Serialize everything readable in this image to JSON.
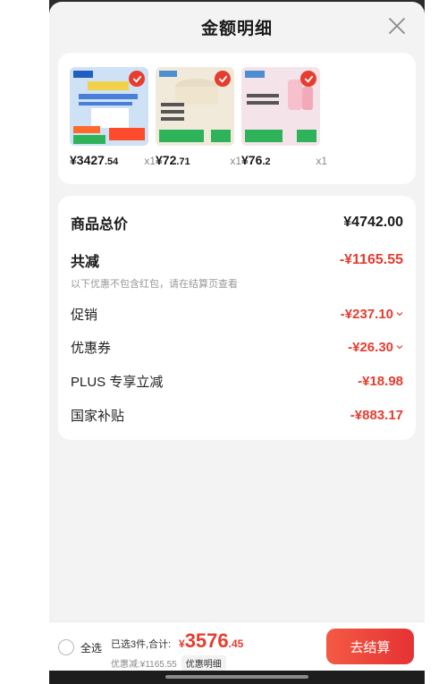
{
  "sheet": {
    "title": "金额明细"
  },
  "products": [
    {
      "price_int": "¥3427",
      "price_dec": ".54",
      "qty": "x1",
      "thumb_color": "#dbe9f7"
    },
    {
      "price_int": "¥72",
      "price_dec": ".71",
      "qty": "x1",
      "thumb_color": "#f4efe3"
    },
    {
      "price_int": "¥76",
      "price_dec": ".2",
      "qty": "x1",
      "thumb_color": "#f7e9ee"
    }
  ],
  "summary": {
    "total_label": "商品总价",
    "total_value": "¥4742.00",
    "reduce_label": "共减",
    "reduce_value": "-¥1165.55",
    "reduce_note": "以下优惠不包含红包，请在结算页查看",
    "items": [
      {
        "label": "促销",
        "value": "-¥237.10",
        "expandable": true
      },
      {
        "label": "优惠券",
        "value": "-¥26.30",
        "expandable": true
      },
      {
        "label": "PLUS 专享立减",
        "value": "-¥18.98",
        "expandable": false
      },
      {
        "label": "国家补贴",
        "value": "-¥883.17",
        "expandable": false
      }
    ]
  },
  "bottom": {
    "select_all": "全选",
    "selected_text": "已选3件,合计:",
    "total_symbol": "¥",
    "total_int": "3576",
    "total_dec": ".45",
    "discount_text": "优惠减:¥1165.55",
    "detail_label": "优惠明细",
    "checkout_label": "去结算"
  },
  "colors": {
    "accent": "#e53d2f",
    "background": "#f3f3f3"
  }
}
